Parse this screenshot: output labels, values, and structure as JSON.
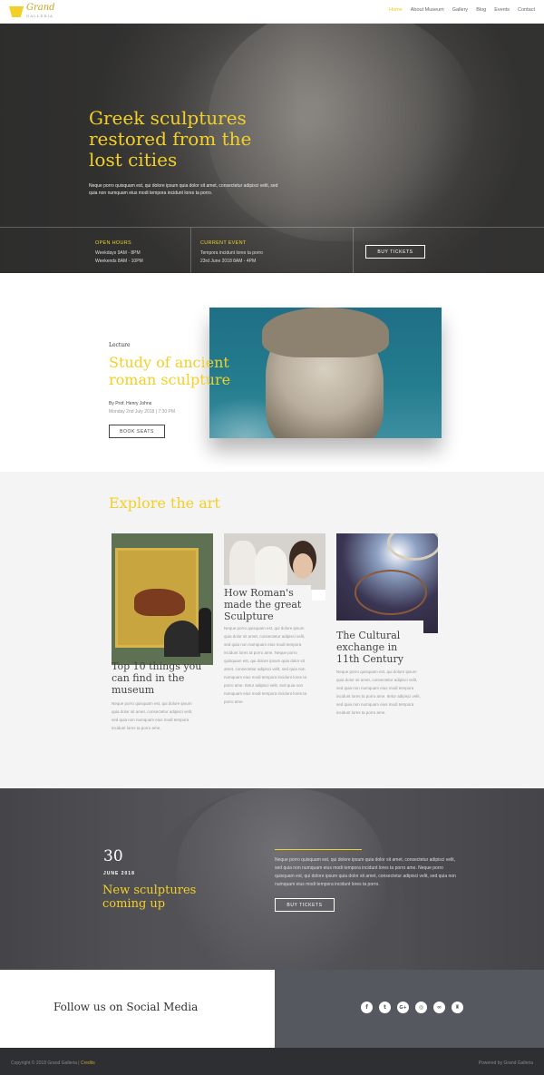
{
  "nav": {
    "logo_text": "Grand",
    "logo_sub": "GALLERIA",
    "items": [
      "Home",
      "About Museum",
      "Gallery",
      "Blog",
      "Events",
      "Contact"
    ],
    "active": "Home"
  },
  "hero": {
    "title": "Greek sculptures restored from the lost cities",
    "text": "Neque porro quisquam est, qui dolore ipsum quia dolor sit amet, consectetur adipisci velit, sed quia non numquam eius modi tempora incidunt lores ta porro.",
    "open_hours": {
      "title": "OPEN HOURS",
      "lines": [
        "Weekdays 9AM - 8PM",
        "Weekends 8AM - 10PM"
      ]
    },
    "current_event": {
      "title": "CURRENT EVENT",
      "lines": [
        "Tempora incidunt lores ta porro",
        "23rd June 2018 8AM - 4PM"
      ]
    },
    "button": "BUY TICKETS"
  },
  "lecture": {
    "kicker": "Lecture",
    "title": "Study of ancient roman sculpture",
    "author": "By Prof. Henry Johns",
    "date": "Monday 2nd July 2018 | 7:30 PM",
    "button": "BOOK SEATS"
  },
  "explore": {
    "title": "Explore the art",
    "cards": [
      {
        "title": "Top 10 things you can find in the museum",
        "text": "Neque porro quisquam est, qui dolore ipsum quia dolor sit amet, consectetur adipisci velit, sed quia non numquam eius modi tempora incidunt lores ta porro ame."
      },
      {
        "title": "How Roman's made the great Sculpture",
        "text": "Neque porro quisquam est, qui dolore ipsum quia dolor sit amet, consectetur adipisci velit, sed quia non numquam eius modi tempora incidunt lores ta porro ame. Neque porro quisquam est, qui dolore ipsum quia dolor sit amet, consectetur adipisci velit, sed quia non numquam eius modi tempora incidunt lores ta porro ame. Itetur adipisci velit, sed quia non numquam eius modi tempora incidunt lores ta porro ame."
      },
      {
        "title": "The Cultural exchange in 11th Century",
        "text": "Neque porro quisquam est, qui dolore ipsum quia dolor sit amet, consectetur adipisci velit, sed quia non numquam eius modi tempora incidunt lores ta porro ame. Itetur adipisci velit, sed quia non numquam eius modi tempora incidunt lores ta porro ame."
      }
    ]
  },
  "event": {
    "day": "30",
    "month": "JUNE 2018",
    "title": "New sculptures coming up",
    "text": "Neque porro quisquam est, qui dolore ipsum quia dolor sit amet, consectetur adipisci velit, sed quia non numquam eius modi tempora incidunt lores ta porro ame. Neque porro quisquam est, qui dolore ipsum quia dolor sit amet, consectetur adipisci velit, sed quia non numquam eius modi tempora incidunt lores ta porro.",
    "button": "BUY TICKETS"
  },
  "social": {
    "title": "Follow us on Social Media",
    "icons": [
      {
        "name": "facebook-icon",
        "glyph": "f"
      },
      {
        "name": "twitter-icon",
        "glyph": "t"
      },
      {
        "name": "google-plus-icon",
        "glyph": "G+"
      },
      {
        "name": "instagram-icon",
        "glyph": "◎"
      },
      {
        "name": "tripadvisor-icon",
        "glyph": "∞"
      },
      {
        "name": "foursquare-icon",
        "glyph": "♜"
      }
    ]
  },
  "footer": {
    "copyright": "Copyright © 2018 Grand Galleria |",
    "credits_link": "Credits",
    "powered": "Powered by Grand Galleria"
  },
  "colors": {
    "accent": "#f2d027",
    "dark_band": "#56585f",
    "footer": "#2e2f33"
  }
}
